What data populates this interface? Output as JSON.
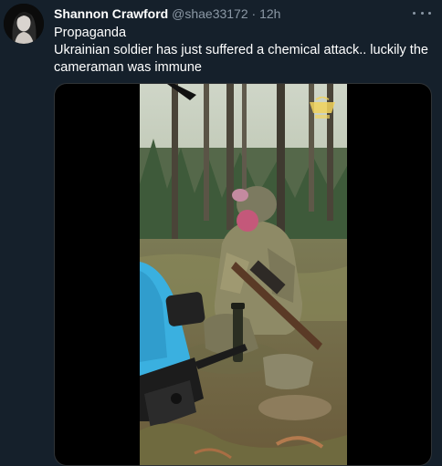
{
  "tweet": {
    "author_name": "Shannon Crawford",
    "handle": "@shae33172",
    "separator": "·",
    "time": "12h",
    "text_lines": [
      "Propaganda",
      "Ukrainian soldier has just suffered a chemical attack.. luckily the",
      "cameraman was immune"
    ]
  },
  "icons": {
    "more": "more-options-icon",
    "video_logo": "channel-logo-icon"
  },
  "colors": {
    "background": "#15202b",
    "secondary_text": "#8b98a5",
    "primary_text": "#ffffff"
  }
}
